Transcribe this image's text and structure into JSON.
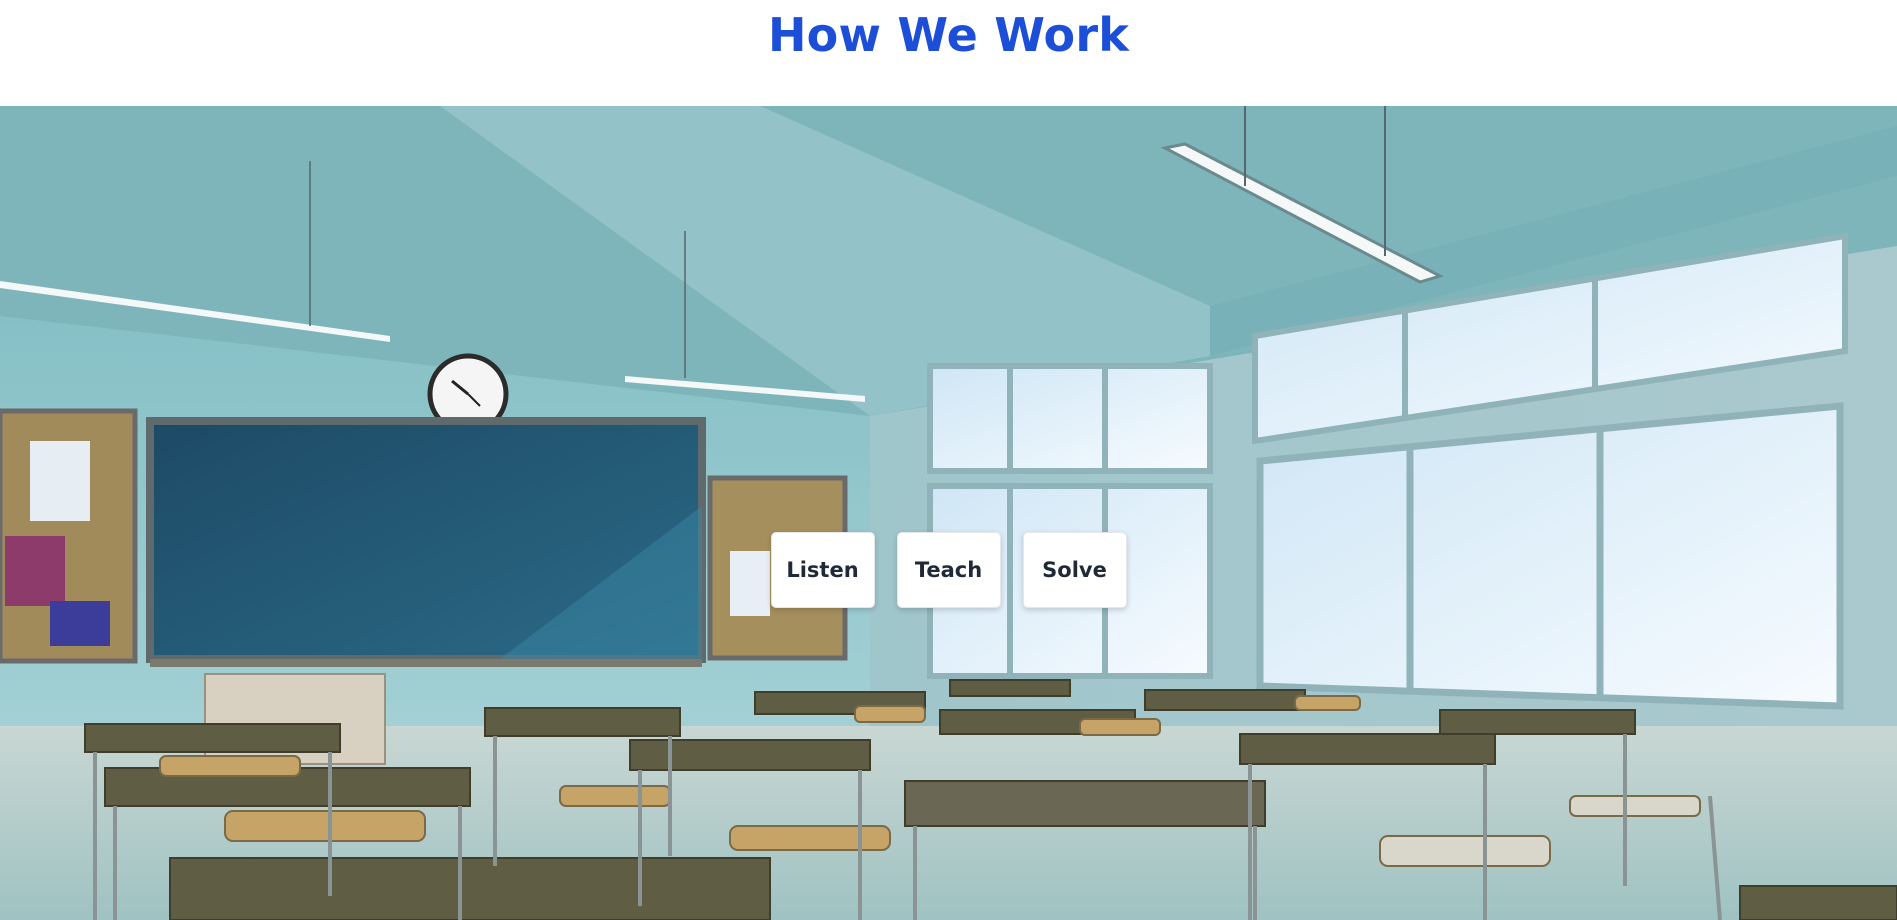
{
  "header": {
    "title": "How We Work"
  },
  "hero": {
    "image_subject": "classroom",
    "steps": [
      {
        "label": "Listen"
      },
      {
        "label": "Teach"
      },
      {
        "label": "Solve"
      }
    ]
  },
  "colors": {
    "title": "#1d4ed8",
    "button_bg": "#ffffff",
    "button_text": "#1f2937"
  }
}
